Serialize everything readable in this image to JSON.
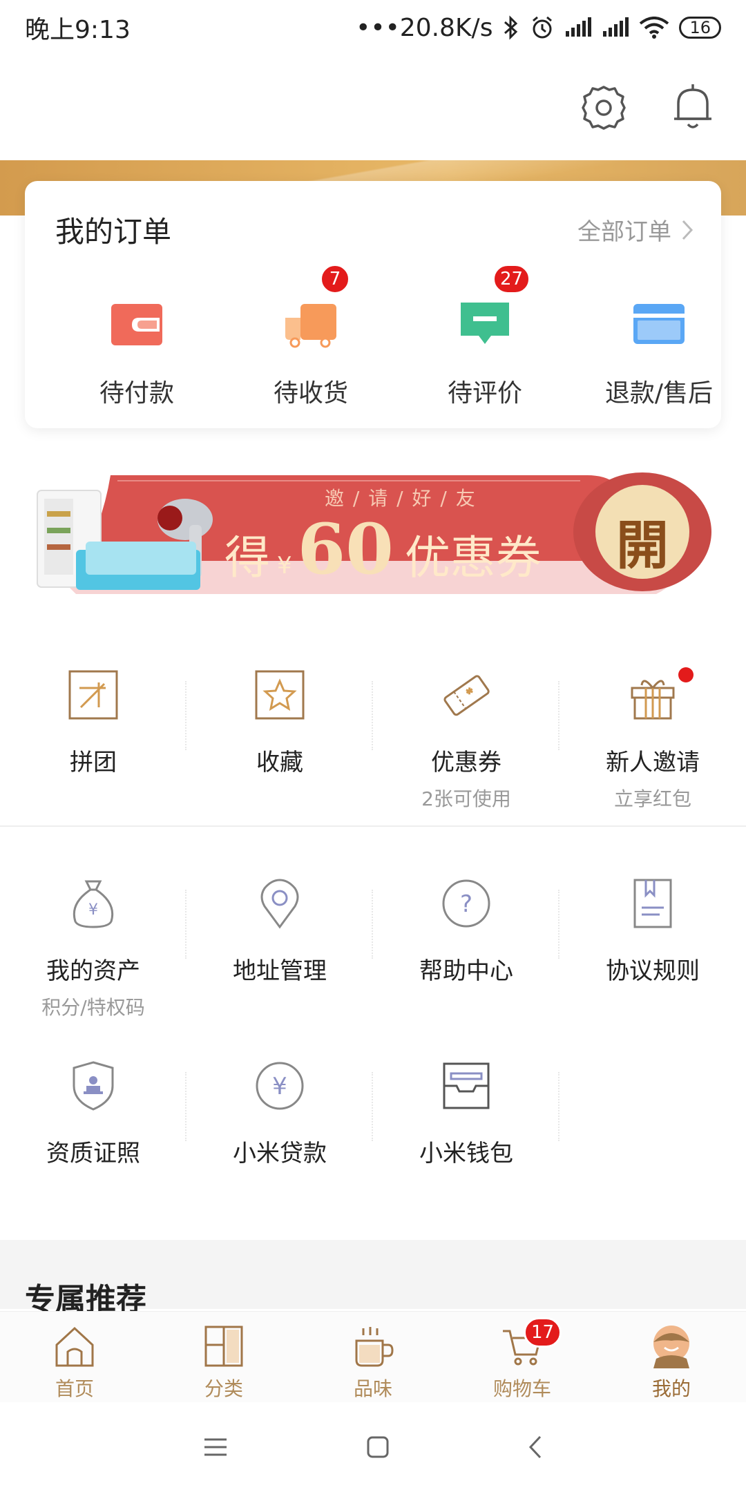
{
  "status_bar": {
    "time": "晚上9:13",
    "network_speed": "•••20.8K/s",
    "battery": "16"
  },
  "header": {
    "settings_icon": "gear-icon",
    "notifications_icon": "bell-icon"
  },
  "orders": {
    "title": "我的订单",
    "all_orders_label": "全部订单",
    "items": [
      {
        "label": "待付款",
        "icon": "wallet-icon",
        "badge": null
      },
      {
        "label": "待收货",
        "icon": "truck-icon",
        "badge": "7"
      },
      {
        "label": "待评价",
        "icon": "comment-icon",
        "badge": "27"
      },
      {
        "label": "退款/售后",
        "icon": "card-icon",
        "badge": null
      }
    ]
  },
  "banner": {
    "top_text": "邀 / 请 / 好 / 友",
    "prefix": "得",
    "currency": "¥",
    "amount": "60",
    "suffix": "优惠券",
    "open_button": "開"
  },
  "services_row1": [
    {
      "label": "拼团",
      "sub": "",
      "icon": "group-buy-icon"
    },
    {
      "label": "收藏",
      "sub": "",
      "icon": "star-icon"
    },
    {
      "label": "优惠券",
      "sub": "2张可使用",
      "icon": "coupon-icon"
    },
    {
      "label": "新人邀请",
      "sub": "立享红包",
      "icon": "gift-icon"
    }
  ],
  "services_row2": [
    {
      "label": "我的资产",
      "sub": "积分/特权码",
      "icon": "money-bag-icon"
    },
    {
      "label": "地址管理",
      "sub": "",
      "icon": "location-icon"
    },
    {
      "label": "帮助中心",
      "sub": "",
      "icon": "help-icon"
    },
    {
      "label": "协议规则",
      "sub": "",
      "icon": "document-icon"
    }
  ],
  "services_row3": [
    {
      "label": "资质证照",
      "sub": "",
      "icon": "shield-badge-icon"
    },
    {
      "label": "小米贷款",
      "sub": "",
      "icon": "yuan-icon"
    },
    {
      "label": "小米钱包",
      "sub": "",
      "icon": "wallet-box-icon"
    }
  ],
  "recommend": {
    "title": "专属推荐"
  },
  "tabbar": [
    {
      "label": "首页",
      "icon": "home-icon"
    },
    {
      "label": "分类",
      "icon": "category-icon"
    },
    {
      "label": "品味",
      "icon": "cup-icon"
    },
    {
      "label": "购物车",
      "icon": "cart-icon",
      "badge": "17"
    },
    {
      "label": "我的",
      "icon": "profile-icon"
    }
  ],
  "colors": {
    "accent_gold": "#d9a35a",
    "badge_red": "#e31b1b",
    "banner_red": "#d9534f"
  }
}
